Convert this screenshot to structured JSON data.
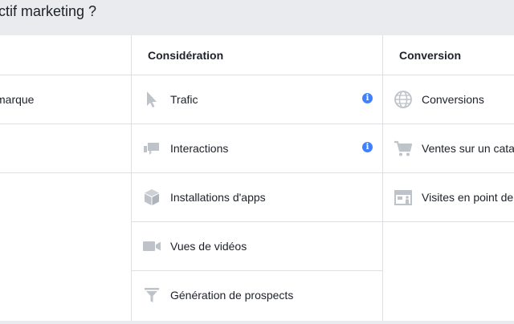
{
  "header": {
    "title": "ctif marketing ?"
  },
  "columns": [
    {
      "header": "",
      "items": [
        {
          "label": "marque"
        }
      ]
    },
    {
      "header": "Considération",
      "items": [
        {
          "label": "Trafic",
          "icon": "cursor-icon",
          "info": true
        },
        {
          "label": "Interactions",
          "icon": "chat-bubbles-icon",
          "info": true
        },
        {
          "label": "Installations d'apps",
          "icon": "box-icon"
        },
        {
          "label": "Vues de vidéos",
          "icon": "video-camera-icon"
        },
        {
          "label": "Génération de prospects",
          "icon": "funnel-icon"
        }
      ]
    },
    {
      "header": "Conversion",
      "items": [
        {
          "label": "Conversions",
          "icon": "globe-icon"
        },
        {
          "label": "Ventes sur un cata",
          "icon": "cart-icon"
        },
        {
          "label": "Visites en point de",
          "icon": "store-icon"
        }
      ]
    }
  ],
  "info_glyph": "i",
  "colors": {
    "accent": "#4080ff",
    "icon_gray": "#bec3c9",
    "divider": "#dddfe2",
    "header_bg": "#e9ebee"
  }
}
